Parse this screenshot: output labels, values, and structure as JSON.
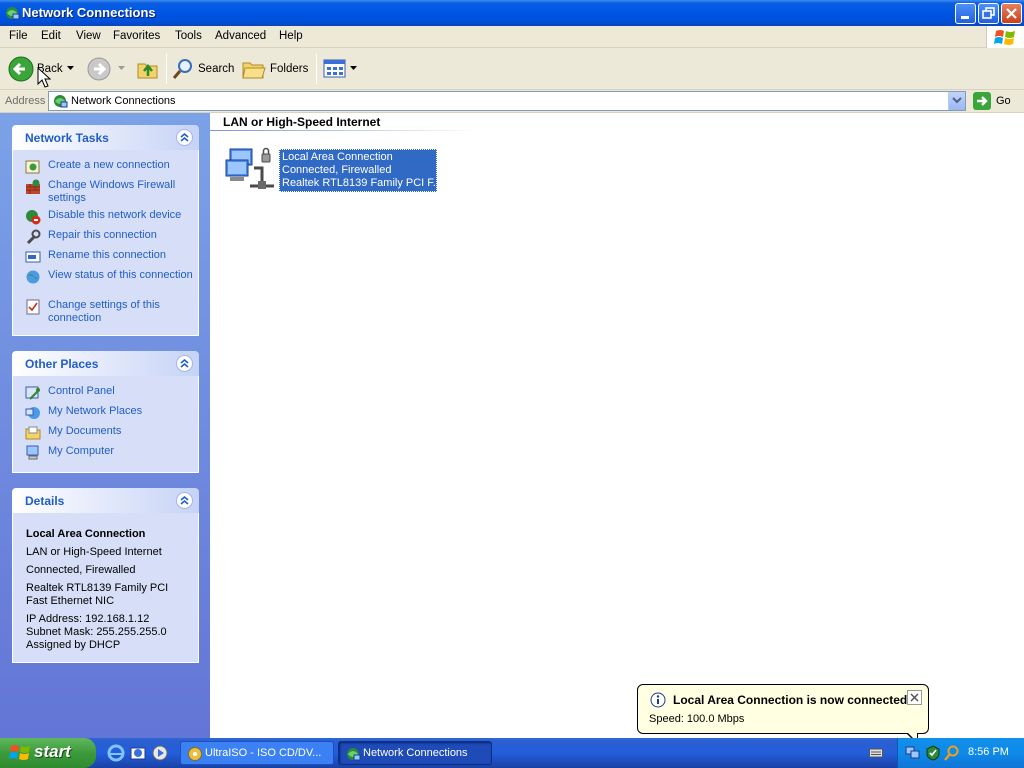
{
  "window": {
    "title": "Network Connections"
  },
  "menu": [
    "File",
    "Edit",
    "View",
    "Favorites",
    "Tools",
    "Advanced",
    "Help"
  ],
  "toolbar": {
    "back": "Back",
    "search": "Search",
    "folders": "Folders"
  },
  "address": {
    "label": "Address",
    "value": "Network Connections",
    "go": "Go"
  },
  "network_tasks": {
    "title": "Network Tasks",
    "items": [
      "Create a new connection",
      "Change Windows Firewall settings",
      "Disable this network device",
      "Repair this connection",
      "Rename this connection",
      "View status of this connection",
      "Change settings of this connection"
    ]
  },
  "other_places": {
    "title": "Other Places",
    "items": [
      "Control Panel",
      "My Network Places",
      "My Documents",
      "My Computer"
    ]
  },
  "details": {
    "title": "Details",
    "name": "Local Area Connection",
    "type": "LAN or High-Speed Internet",
    "status": "Connected, Firewalled",
    "device": "Realtek RTL8139 Family PCI Fast Ethernet NIC",
    "ip": "IP Address: 192.168.1.12",
    "subnet": "Subnet Mask: 255.255.255.0",
    "assigned": "Assigned by DHCP"
  },
  "content": {
    "group_header": "LAN or High-Speed Internet",
    "connection": {
      "name": "Local Area Connection",
      "status": "Connected, Firewalled",
      "device": "Realtek RTL8139 Family PCI F..."
    }
  },
  "balloon": {
    "title": "Local Area Connection is now connected",
    "body": "Speed: 100.0 Mbps"
  },
  "taskbar": {
    "start": "start",
    "tasks": [
      "UltraISO - ISO CD/DV...",
      "Network Connections"
    ],
    "clock": "8:56 PM"
  },
  "colors": {
    "titlebar": "#0055e5",
    "link": "#215dc6",
    "selection": "#316ac5",
    "taskpane": "#6375d6",
    "balloon": "#ffffe1"
  }
}
